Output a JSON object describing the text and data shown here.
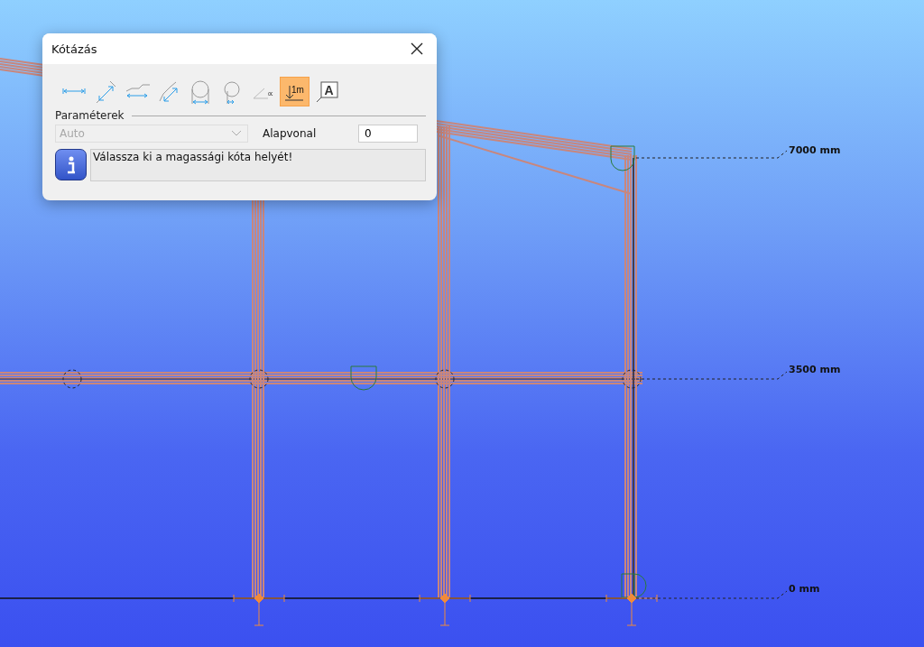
{
  "dialog": {
    "title": "Kótázás",
    "tools": [
      {
        "kind": "horizontal",
        "selected": false
      },
      {
        "kind": "aligned",
        "selected": false
      },
      {
        "kind": "stepped",
        "selected": false
      },
      {
        "kind": "aligned-stepped",
        "selected": false
      },
      {
        "kind": "diameter",
        "selected": false
      },
      {
        "kind": "radius",
        "selected": false
      },
      {
        "kind": "angle",
        "selected": false,
        "label": "∝"
      },
      {
        "kind": "level",
        "selected": true,
        "label": "1m"
      },
      {
        "kind": "text",
        "selected": false,
        "label": "A"
      }
    ],
    "section_label": "Paraméterek",
    "mode_select": {
      "value": "Auto",
      "disabled": true
    },
    "baseline": {
      "label": "Alapvonal",
      "value": "0"
    },
    "message": "Válassza ki a magassági kóta helyét!"
  },
  "levels": [
    {
      "label": "7000 mm"
    },
    {
      "label": "3500 mm"
    },
    {
      "label": "0 mm"
    }
  ]
}
